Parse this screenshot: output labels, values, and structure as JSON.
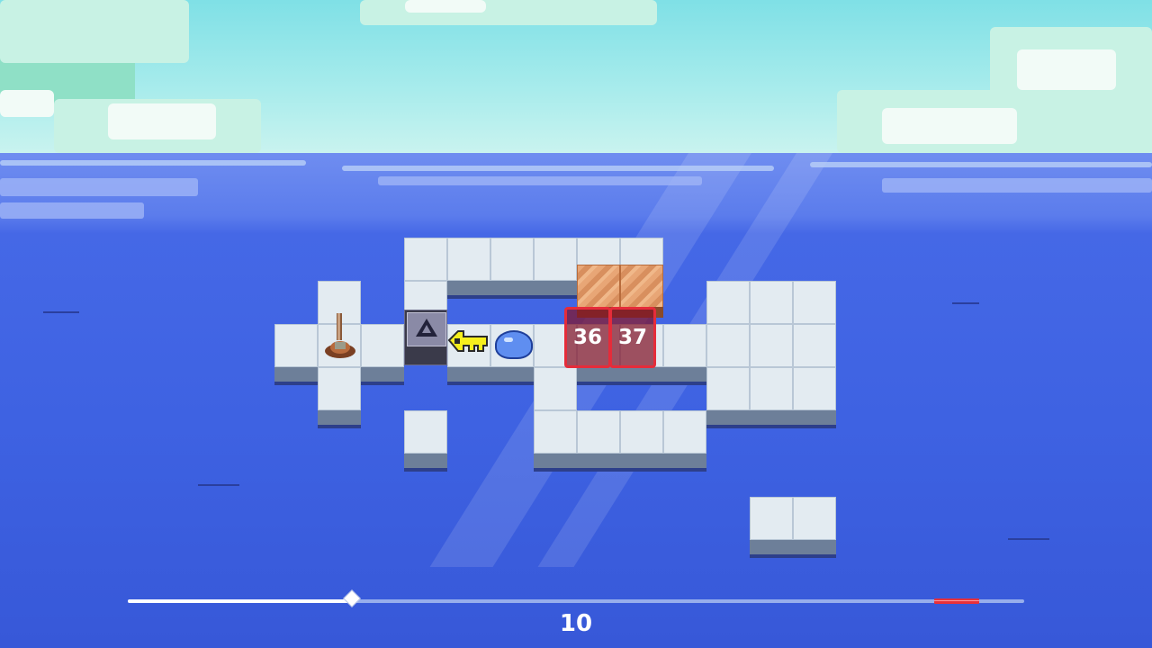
{
  "level": {
    "traps": [
      {
        "label": "36"
      },
      {
        "label": "37"
      }
    ],
    "pieces": {
      "lever": "lever-icon",
      "lock": "lock-block-icon",
      "key": "key-icon",
      "player": "slime-icon"
    }
  },
  "timeline": {
    "turn": "10",
    "progress": 0.25,
    "trap_marker": [
      0.9,
      0.95
    ]
  },
  "colors": {
    "sea": "#3e62e2",
    "tile": "#e3ebf1",
    "trap": "#e52c3a",
    "key": "#f6ef1c"
  }
}
